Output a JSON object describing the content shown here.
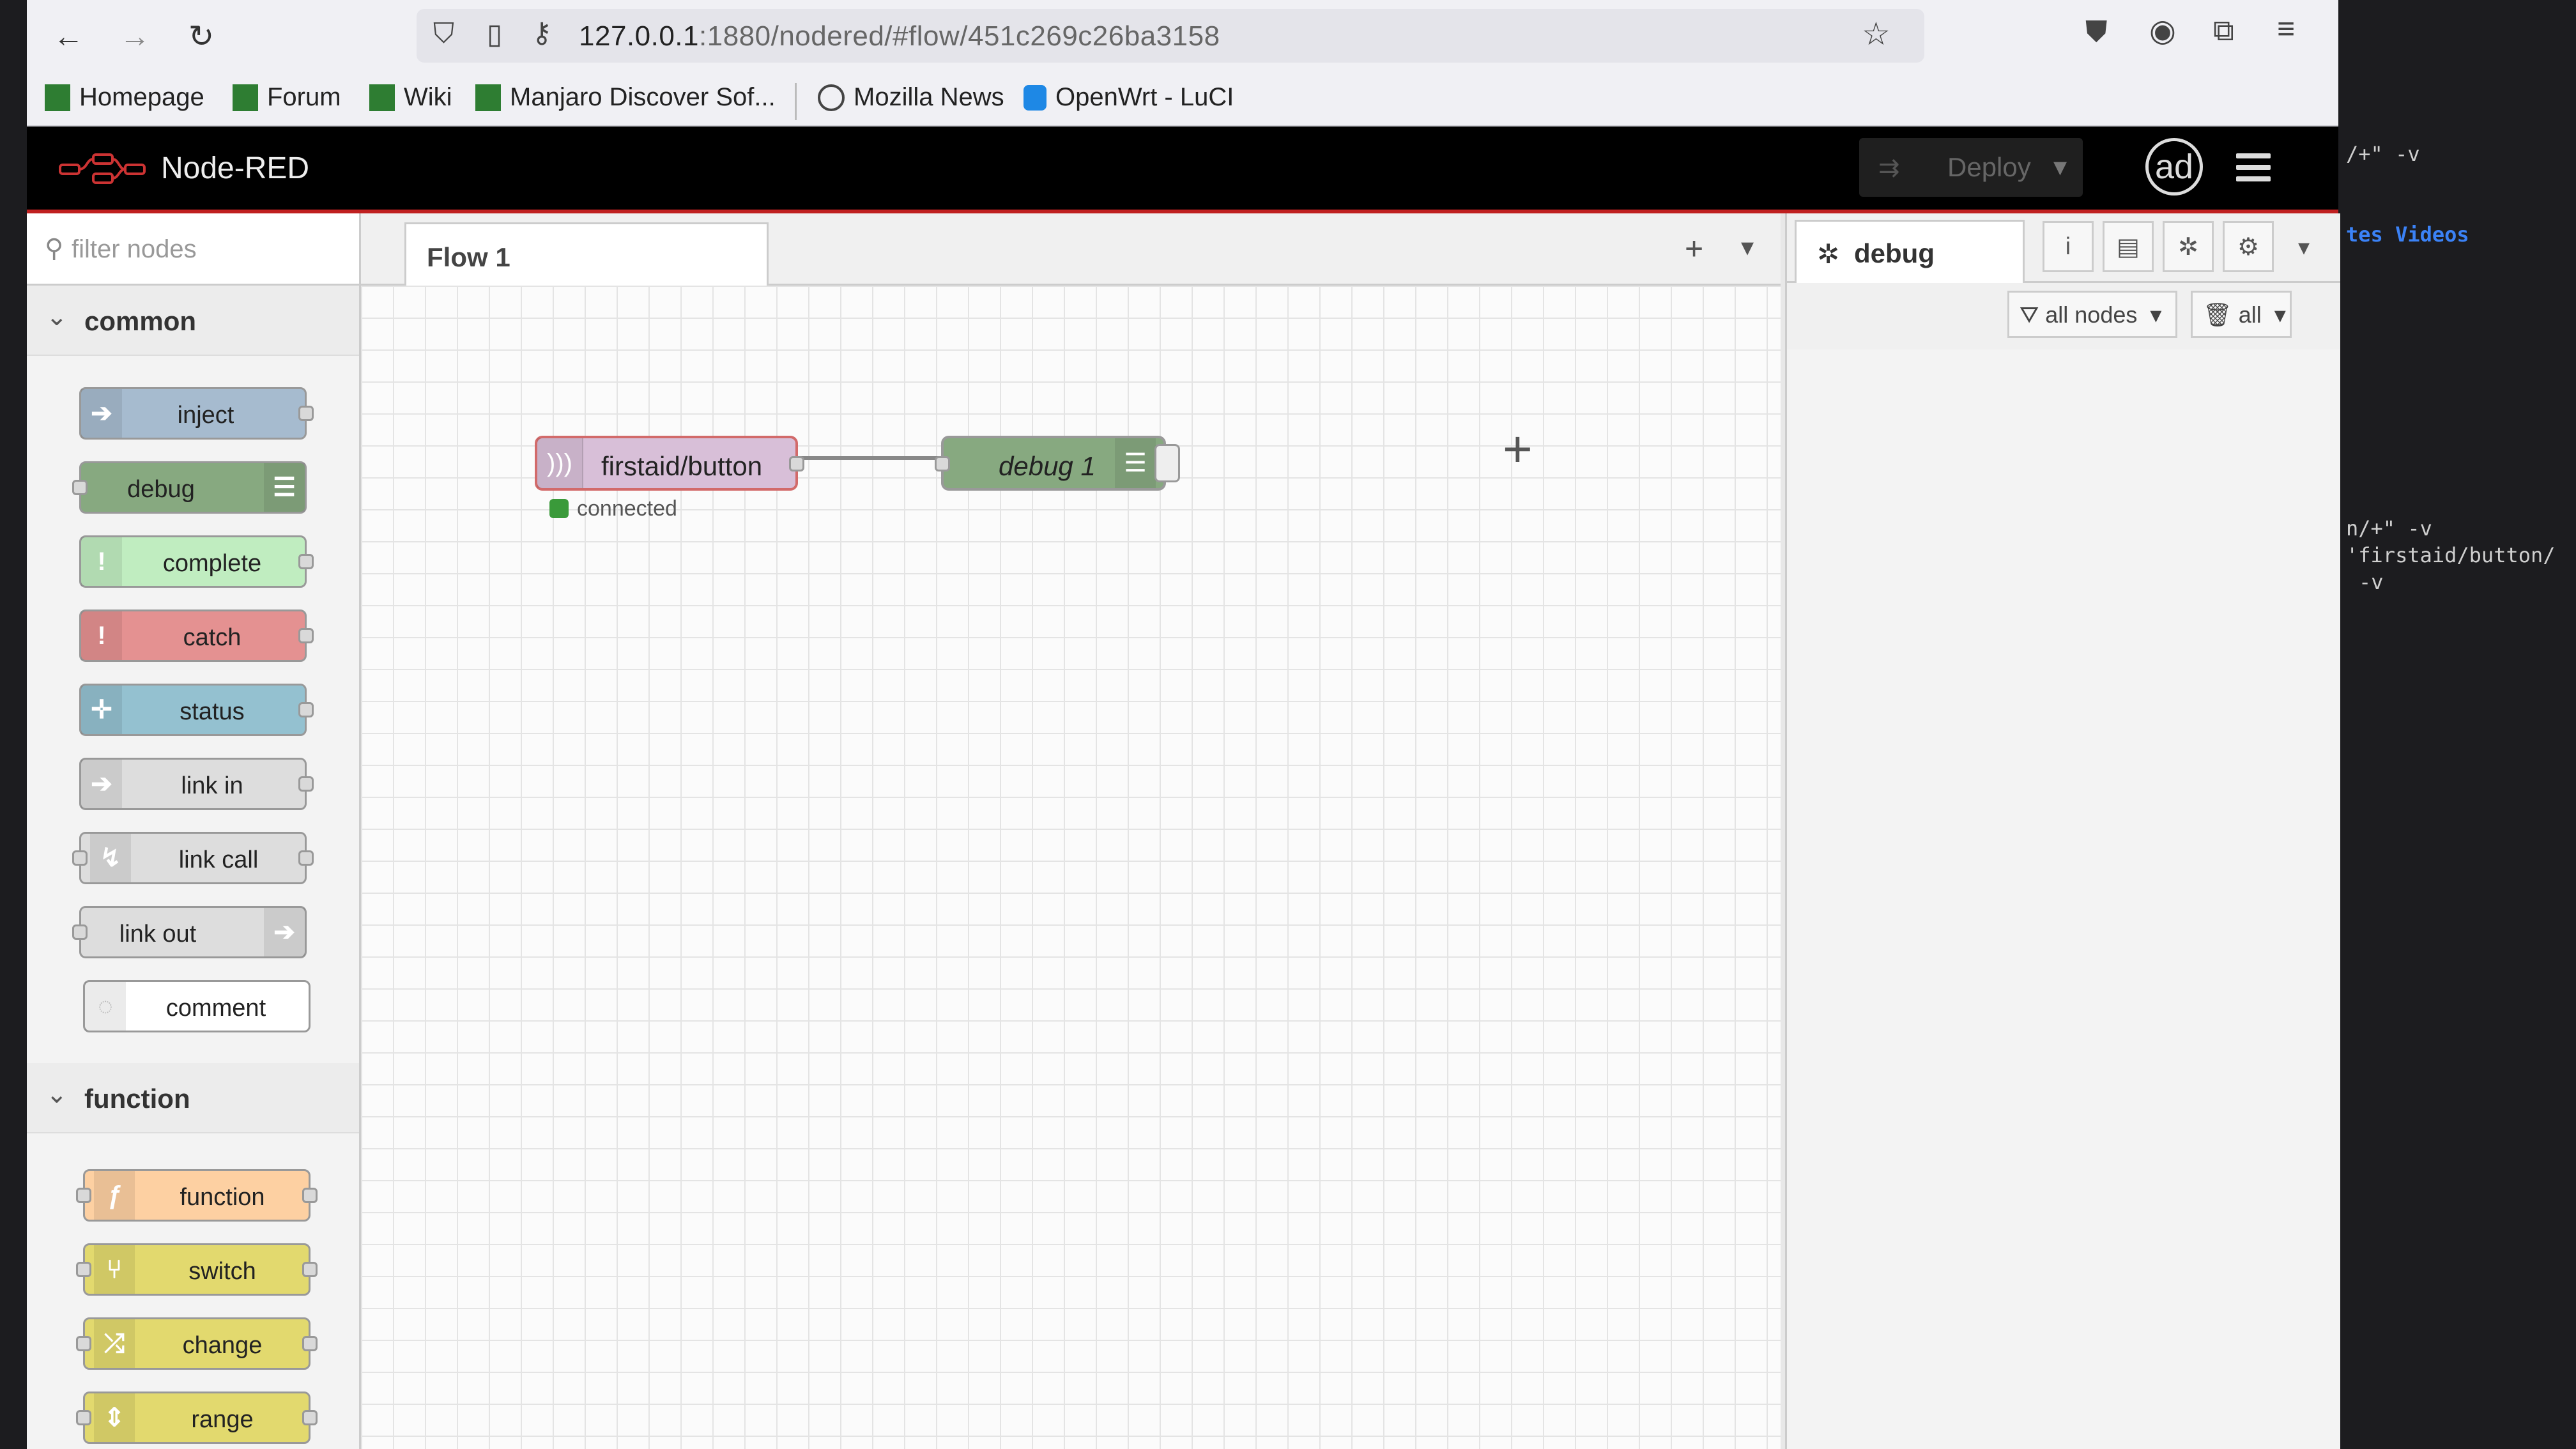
{
  "browser": {
    "url_host": "127.0.0.1",
    "url_rest": ":1880/nodered/#flow/451c269c26ba3158",
    "bookmarks": [
      "Homepage",
      "Forum",
      "Wiki",
      "Manjaro Discover Sof...",
      "Mozilla News",
      "OpenWrt - LuCI"
    ]
  },
  "header": {
    "title": "Node-RED",
    "deploy_label": "Deploy",
    "avatar_initials": "ad"
  },
  "palette": {
    "filter_placeholder": "filter nodes",
    "categories": [
      {
        "name": "common",
        "nodes": [
          "inject",
          "debug",
          "complete",
          "catch",
          "status",
          "link in",
          "link call",
          "link out",
          "comment"
        ]
      },
      {
        "name": "function",
        "nodes": [
          "function",
          "switch",
          "change",
          "range"
        ]
      }
    ]
  },
  "workspace": {
    "tabs": [
      {
        "label": "Flow 1"
      }
    ],
    "nodes": [
      {
        "label": "firstaid/button",
        "status": "connected"
      },
      {
        "label": "debug 1"
      }
    ]
  },
  "sidebar": {
    "active_tab": "debug",
    "filter_label": "all nodes",
    "clear_label": "all"
  },
  "terminal": {
    "lines": [
      "/+\" -v",
      "tes  Videos",
      "n/+\" -v",
      "'firstaid/button/",
      "-v"
    ]
  },
  "colors": {
    "inject": "#a6bbcf",
    "debug": "#87a980",
    "complete": "#c0edc0",
    "catch": "#e49191",
    "status": "#94c1d0",
    "link": "#dddddd",
    "function": "#fdd0a2",
    "mqtt": "#d8bfd8",
    "accent_red": "#c02020"
  }
}
